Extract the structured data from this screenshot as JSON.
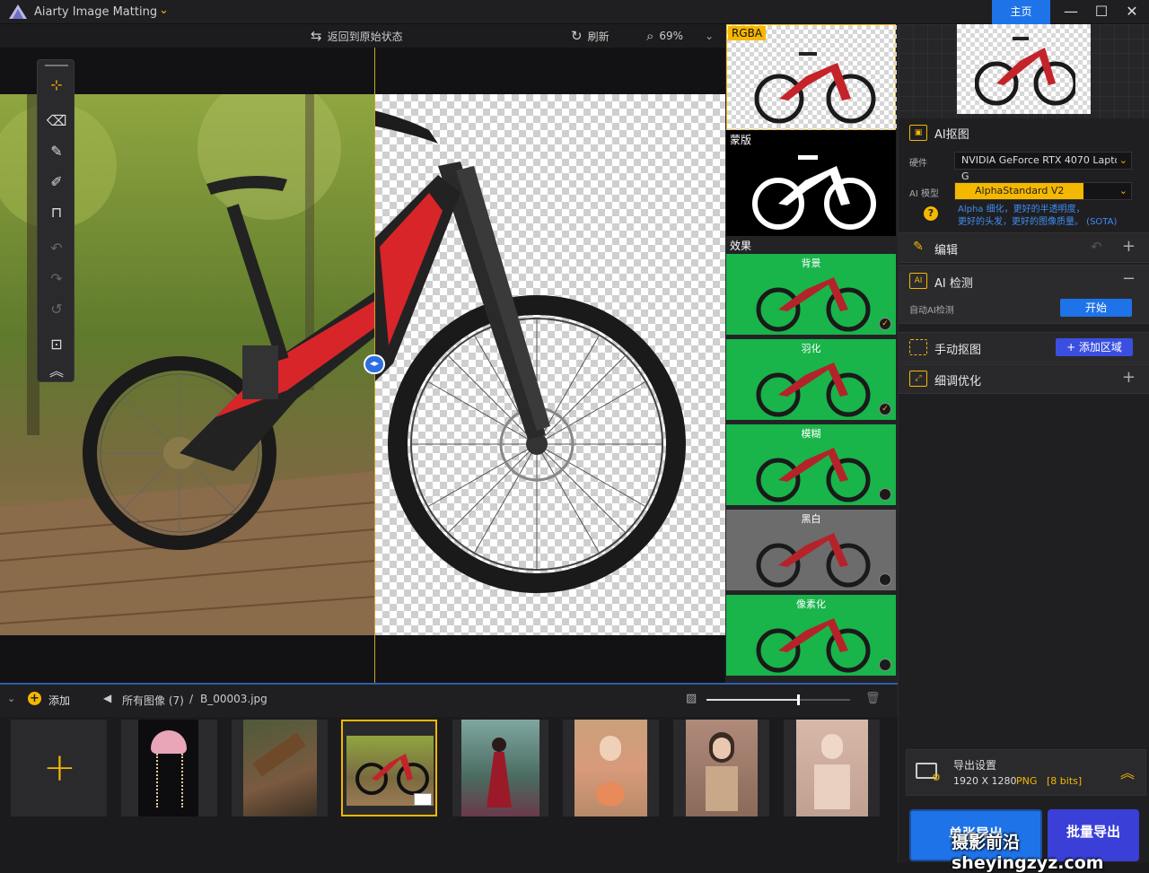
{
  "titlebar": {
    "app_title": "Aiarty Image Matting",
    "home_label": "主页",
    "minimize": "—",
    "maximize": "☐",
    "close": "✕"
  },
  "toolbar": {
    "revert_label": "返回到原始状态",
    "refresh_label": "刷新",
    "zoom_value": "69%"
  },
  "thumbs": {
    "rgba_label": "RGBA",
    "mask_label": "蒙版",
    "effects_label": "效果",
    "effects": [
      {
        "label": "背景",
        "checked": true
      },
      {
        "label": "羽化",
        "checked": true
      },
      {
        "label": "模糊",
        "checked": false
      },
      {
        "label": "黑白",
        "checked": false
      },
      {
        "label": "像素化",
        "checked": false
      }
    ]
  },
  "sidebar": {
    "ai_matting": {
      "title": "AI抠图",
      "hardware_label": "硬件",
      "hardware_value": "NVIDIA GeForce RTX 4070 Laptop G",
      "model_label": "AI 模型",
      "model_value": "AlphaStandard  V2",
      "model_desc_1": "Alpha 细化，更好的半透明度，",
      "model_desc_2": "更好的头发，更好的图像质量。 (SOTA)"
    },
    "edit": {
      "title": "编辑"
    },
    "ai_detect": {
      "title": "AI 检测",
      "auto_label": "自动AI检测",
      "start_button": "开始"
    },
    "manual": {
      "title": "手动抠图",
      "add_region_button": "+ 添加区域"
    },
    "refine": {
      "title": "细调优化"
    },
    "export": {
      "title": "导出设置",
      "size": "1920 X 1280",
      "format": "PNG",
      "bits": "[8 bits]"
    },
    "single_export": "单张导出",
    "batch_export": "批量导出"
  },
  "bottom": {
    "add_label": "添加",
    "breadcrumb_all": "所有图像 (7)",
    "breadcrumb_sep": "/",
    "breadcrumb_file": "B_00003.jpg",
    "slider_fraction": 0.64
  },
  "watermark": "摄影前沿sheyingzyz.com",
  "colors": {
    "accent": "#f5b800",
    "blue": "#1e73e8",
    "green": "#19b44a"
  }
}
